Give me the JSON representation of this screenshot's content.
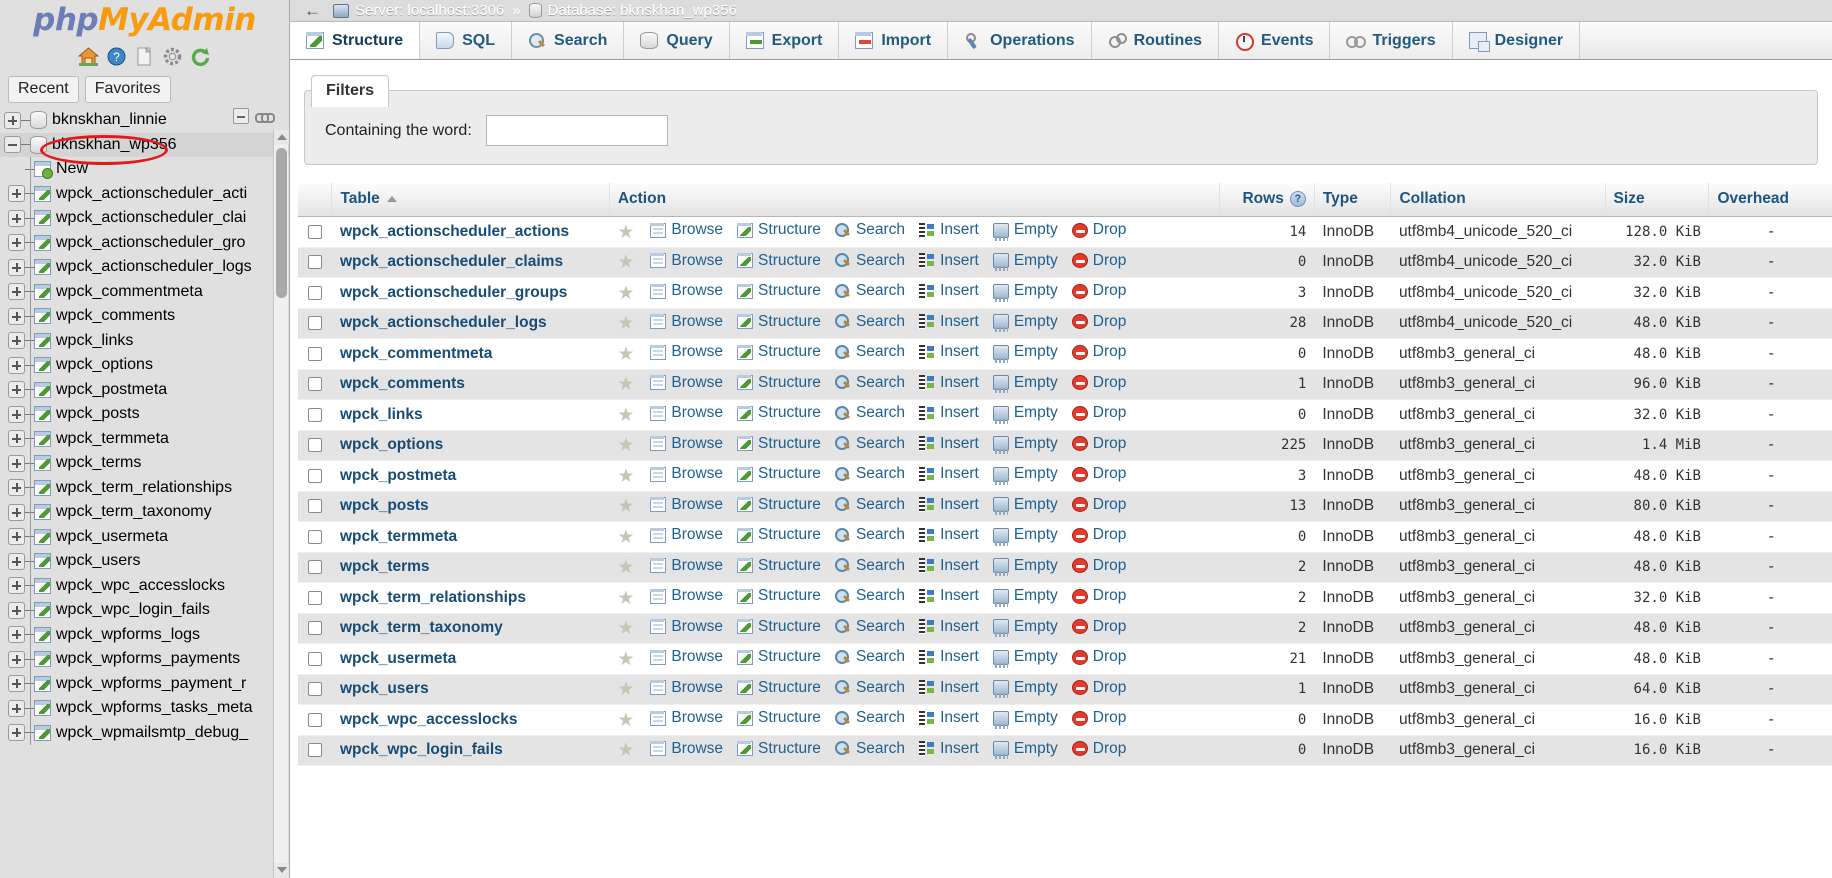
{
  "brand": {
    "php": "php",
    "my": "My",
    "admin": "Admin"
  },
  "sidebar": {
    "logo_icons": [
      "home-icon",
      "help-icon",
      "docs-icon",
      "settings-icon",
      "reload-icon"
    ],
    "tabs": [
      {
        "label": "Recent",
        "name": "recent-tab"
      },
      {
        "label": "Favorites",
        "name": "favorites-tab"
      }
    ],
    "collapse_icons": [
      "collapse-all-icon",
      "link-with-main-panel-icon"
    ],
    "tree": [
      {
        "label": "bknskhan_linnie",
        "type": "database",
        "expander": "plus",
        "selected": false
      },
      {
        "label": "bknskhan_wp356",
        "type": "database",
        "expander": "minus",
        "selected": true,
        "highlighted": true
      },
      {
        "label": "New",
        "type": "new",
        "expander": "none",
        "selected": false
      },
      {
        "label": "wpck_actionscheduler_acti",
        "type": "table",
        "expander": "plus",
        "selected": false
      },
      {
        "label": "wpck_actionscheduler_clai",
        "type": "table",
        "expander": "plus",
        "selected": false
      },
      {
        "label": "wpck_actionscheduler_gro",
        "type": "table",
        "expander": "plus",
        "selected": false
      },
      {
        "label": "wpck_actionscheduler_logs",
        "type": "table",
        "expander": "plus",
        "selected": false
      },
      {
        "label": "wpck_commentmeta",
        "type": "table",
        "expander": "plus",
        "selected": false
      },
      {
        "label": "wpck_comments",
        "type": "table",
        "expander": "plus",
        "selected": false
      },
      {
        "label": "wpck_links",
        "type": "table",
        "expander": "plus",
        "selected": false
      },
      {
        "label": "wpck_options",
        "type": "table",
        "expander": "plus",
        "selected": false
      },
      {
        "label": "wpck_postmeta",
        "type": "table",
        "expander": "plus",
        "selected": false
      },
      {
        "label": "wpck_posts",
        "type": "table",
        "expander": "plus",
        "selected": false
      },
      {
        "label": "wpck_termmeta",
        "type": "table",
        "expander": "plus",
        "selected": false
      },
      {
        "label": "wpck_terms",
        "type": "table",
        "expander": "plus",
        "selected": false
      },
      {
        "label": "wpck_term_relationships",
        "type": "table",
        "expander": "plus",
        "selected": false
      },
      {
        "label": "wpck_term_taxonomy",
        "type": "table",
        "expander": "plus",
        "selected": false
      },
      {
        "label": "wpck_usermeta",
        "type": "table",
        "expander": "plus",
        "selected": false
      },
      {
        "label": "wpck_users",
        "type": "table",
        "expander": "plus",
        "selected": false
      },
      {
        "label": "wpck_wpc_accesslocks",
        "type": "table",
        "expander": "plus",
        "selected": false
      },
      {
        "label": "wpck_wpc_login_fails",
        "type": "table",
        "expander": "plus",
        "selected": false
      },
      {
        "label": "wpck_wpforms_logs",
        "type": "table",
        "expander": "plus",
        "selected": false
      },
      {
        "label": "wpck_wpforms_payments",
        "type": "table",
        "expander": "plus",
        "selected": false
      },
      {
        "label": "wpck_wpforms_payment_r",
        "type": "table",
        "expander": "plus",
        "selected": false
      },
      {
        "label": "wpck_wpforms_tasks_meta",
        "type": "table",
        "expander": "plus",
        "selected": false
      },
      {
        "label": "wpck_wpmailsmtp_debug_",
        "type": "table",
        "expander": "plus",
        "selected": false
      }
    ]
  },
  "breadcrumb": {
    "back": "←",
    "server_icon": "server-icon",
    "server": "Server: localhost:3306",
    "separator": "»",
    "database_icon": "database-icon",
    "database": "Database: bknskhan_wp356"
  },
  "tabs": [
    {
      "label": "Structure",
      "icon": "structure-icon",
      "active": true
    },
    {
      "label": "SQL",
      "icon": "sql-icon",
      "active": false
    },
    {
      "label": "Search",
      "icon": "search-icon",
      "active": false
    },
    {
      "label": "Query",
      "icon": "query-icon",
      "active": false
    },
    {
      "label": "Export",
      "icon": "export-icon",
      "active": false
    },
    {
      "label": "Import",
      "icon": "import-icon",
      "active": false
    },
    {
      "label": "Operations",
      "icon": "operations-icon",
      "active": false
    },
    {
      "label": "Routines",
      "icon": "routines-icon",
      "active": false
    },
    {
      "label": "Events",
      "icon": "events-icon",
      "active": false
    },
    {
      "label": "Triggers",
      "icon": "triggers-icon",
      "active": false
    },
    {
      "label": "Designer",
      "icon": "designer-icon",
      "active": false
    }
  ],
  "filters": {
    "legend": "Filters",
    "containing_label": "Containing the word:",
    "containing_value": "",
    "containing_placeholder": ""
  },
  "table": {
    "headers": {
      "table": "Table",
      "action": "Action",
      "rows": "Rows",
      "rows_help": "?",
      "type": "Type",
      "collation": "Collation",
      "size": "Size",
      "overhead": "Overhead"
    },
    "sort_column": "Table",
    "sort_direction": "asc",
    "actions": [
      "Browse",
      "Structure",
      "Search",
      "Insert",
      "Empty",
      "Drop"
    ],
    "rows": [
      {
        "name": "wpck_actionscheduler_actions",
        "rows": "14",
        "type": "InnoDB",
        "collation": "utf8mb4_unicode_520_ci",
        "size": "128.0 KiB",
        "overhead": "-"
      },
      {
        "name": "wpck_actionscheduler_claims",
        "rows": "0",
        "type": "InnoDB",
        "collation": "utf8mb4_unicode_520_ci",
        "size": "32.0 KiB",
        "overhead": "-"
      },
      {
        "name": "wpck_actionscheduler_groups",
        "rows": "3",
        "type": "InnoDB",
        "collation": "utf8mb4_unicode_520_ci",
        "size": "32.0 KiB",
        "overhead": "-"
      },
      {
        "name": "wpck_actionscheduler_logs",
        "rows": "28",
        "type": "InnoDB",
        "collation": "utf8mb4_unicode_520_ci",
        "size": "48.0 KiB",
        "overhead": "-"
      },
      {
        "name": "wpck_commentmeta",
        "rows": "0",
        "type": "InnoDB",
        "collation": "utf8mb3_general_ci",
        "size": "48.0 KiB",
        "overhead": "-"
      },
      {
        "name": "wpck_comments",
        "rows": "1",
        "type": "InnoDB",
        "collation": "utf8mb3_general_ci",
        "size": "96.0 KiB",
        "overhead": "-"
      },
      {
        "name": "wpck_links",
        "rows": "0",
        "type": "InnoDB",
        "collation": "utf8mb3_general_ci",
        "size": "32.0 KiB",
        "overhead": "-"
      },
      {
        "name": "wpck_options",
        "rows": "225",
        "type": "InnoDB",
        "collation": "utf8mb3_general_ci",
        "size": "1.4 MiB",
        "overhead": "-"
      },
      {
        "name": "wpck_postmeta",
        "rows": "3",
        "type": "InnoDB",
        "collation": "utf8mb3_general_ci",
        "size": "48.0 KiB",
        "overhead": "-"
      },
      {
        "name": "wpck_posts",
        "rows": "13",
        "type": "InnoDB",
        "collation": "utf8mb3_general_ci",
        "size": "80.0 KiB",
        "overhead": "-"
      },
      {
        "name": "wpck_termmeta",
        "rows": "0",
        "type": "InnoDB",
        "collation": "utf8mb3_general_ci",
        "size": "48.0 KiB",
        "overhead": "-"
      },
      {
        "name": "wpck_terms",
        "rows": "2",
        "type": "InnoDB",
        "collation": "utf8mb3_general_ci",
        "size": "48.0 KiB",
        "overhead": "-"
      },
      {
        "name": "wpck_term_relationships",
        "rows": "2",
        "type": "InnoDB",
        "collation": "utf8mb3_general_ci",
        "size": "32.0 KiB",
        "overhead": "-"
      },
      {
        "name": "wpck_term_taxonomy",
        "rows": "2",
        "type": "InnoDB",
        "collation": "utf8mb3_general_ci",
        "size": "48.0 KiB",
        "overhead": "-"
      },
      {
        "name": "wpck_usermeta",
        "rows": "21",
        "type": "InnoDB",
        "collation": "utf8mb3_general_ci",
        "size": "48.0 KiB",
        "overhead": "-"
      },
      {
        "name": "wpck_users",
        "rows": "1",
        "type": "InnoDB",
        "collation": "utf8mb3_general_ci",
        "size": "64.0 KiB",
        "overhead": "-"
      },
      {
        "name": "wpck_wpc_accesslocks",
        "rows": "0",
        "type": "InnoDB",
        "collation": "utf8mb3_general_ci",
        "size": "16.0 KiB",
        "overhead": "-"
      },
      {
        "name": "wpck_wpc_login_fails",
        "rows": "0",
        "type": "InnoDB",
        "collation": "utf8mb3_general_ci",
        "size": "16.0 KiB",
        "overhead": "-"
      }
    ]
  },
  "colors": {
    "link": "#1f6193",
    "header_link": "#1b5583",
    "highlight": "#e01b1b",
    "brand_blue": "#6c7eb7",
    "brand_orange": "#f89b0f",
    "row_even": "#e4e4e4"
  }
}
